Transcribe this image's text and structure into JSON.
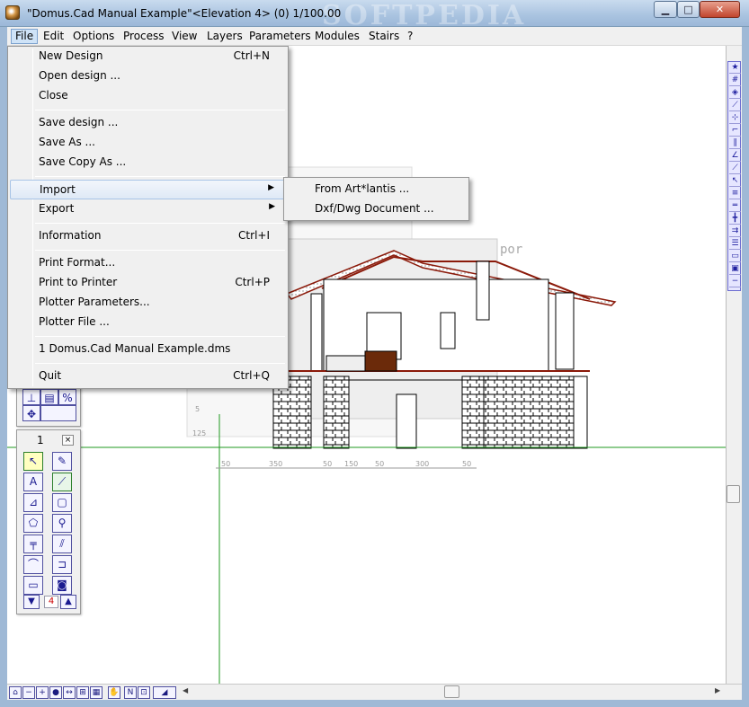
{
  "window": {
    "title": "\"Domus.Cad Manual Example\"<Elevation 4> (0) 1/100.00",
    "watermark": "SOFTPEDIA"
  },
  "menubar": {
    "items": [
      "File",
      "Edit",
      "Options",
      "Process",
      "View",
      "Layers",
      "Parameters",
      "Modules",
      "Stairs",
      "?"
    ]
  },
  "file_menu": {
    "items": [
      {
        "label": "New Design",
        "shortcut": "Ctrl+N"
      },
      {
        "label": "Open design ...",
        "shortcut": ""
      },
      {
        "label": "Close",
        "shortcut": ""
      },
      {
        "label": "Save design ...",
        "shortcut": ""
      },
      {
        "label": "Save As ...",
        "shortcut": ""
      },
      {
        "label": "Save Copy As ...",
        "shortcut": ""
      },
      {
        "label": "Import",
        "shortcut": ""
      },
      {
        "label": "Export",
        "shortcut": ""
      },
      {
        "label": "Information",
        "shortcut": "Ctrl+I"
      },
      {
        "label": "Print Format...",
        "shortcut": ""
      },
      {
        "label": "Print to Printer",
        "shortcut": "Ctrl+P"
      },
      {
        "label": "Plotter Parameters...",
        "shortcut": ""
      },
      {
        "label": "Plotter File ...",
        "shortcut": ""
      },
      {
        "label": "1 Domus.Cad Manual Example.dms",
        "shortcut": ""
      },
      {
        "label": "Quit",
        "shortcut": "Ctrl+Q"
      }
    ]
  },
  "import_submenu": {
    "items": [
      "From Art*lantis ...",
      "Dxf/Dwg Document ..."
    ]
  },
  "drawing": {
    "label_text": "por",
    "dimensions": [
      "50",
      "350",
      "50",
      "150",
      "50",
      "300",
      "50"
    ],
    "vertical_dims": [
      "5",
      "125"
    ]
  },
  "palette": {
    "number": "1",
    "close_glyph": "×",
    "counter": "4"
  },
  "colors": {
    "roof": "#8b1a0a",
    "guide_line": "#1f9a1f",
    "toolbar_blue": "#1a1a90"
  }
}
